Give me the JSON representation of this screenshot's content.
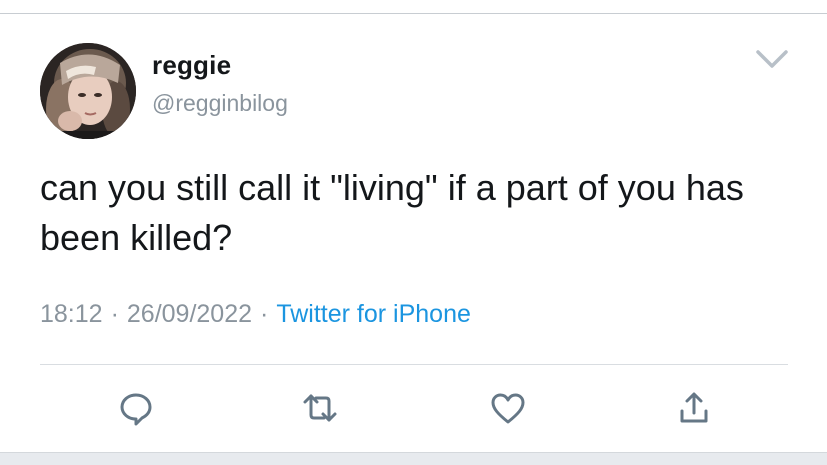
{
  "tweet": {
    "author": {
      "display_name": "reggie",
      "handle": "@regginbilog"
    },
    "text": "can you still call it \"living\" if a part of you has been killed?",
    "time": "18:12",
    "date": "26/09/2022",
    "separator": "·",
    "source": "Twitter for iPhone"
  },
  "icons": {
    "menu": "chevron-down-icon",
    "reply": "reply-icon",
    "retweet": "retweet-icon",
    "like": "heart-icon",
    "share": "share-icon"
  },
  "colors": {
    "text": "#14171a",
    "muted": "#8a949d",
    "link": "#1b95e0",
    "action_icon": "#657786"
  }
}
